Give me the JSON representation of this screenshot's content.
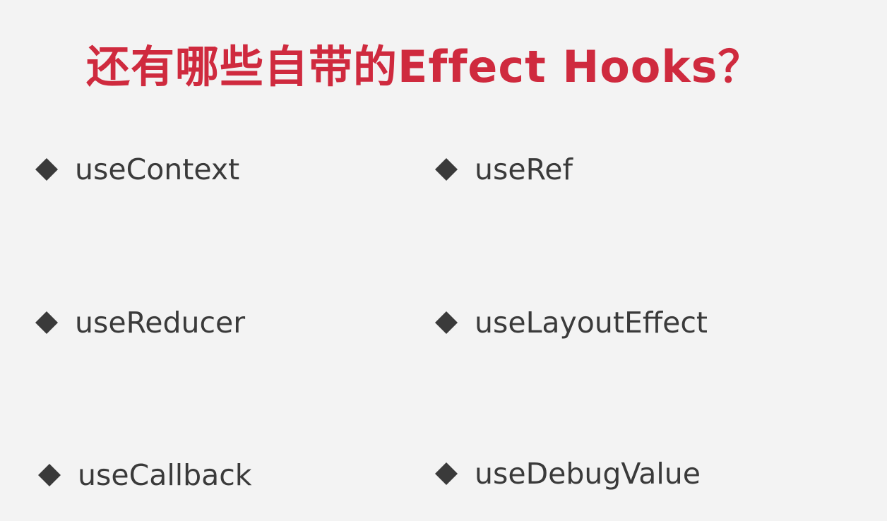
{
  "slide": {
    "title": "还有哪些自带的Effect Hooks？",
    "title_color": "#cf2a3e",
    "text_color": "#3a3a3a",
    "bullet_icon": "diamond-icon",
    "items": [
      {
        "label": "useContext"
      },
      {
        "label": "useRef"
      },
      {
        "label": "useReducer"
      },
      {
        "label": "useLayoutEffect"
      },
      {
        "label": "useCallback"
      },
      {
        "label": "useDebugValue"
      }
    ]
  }
}
